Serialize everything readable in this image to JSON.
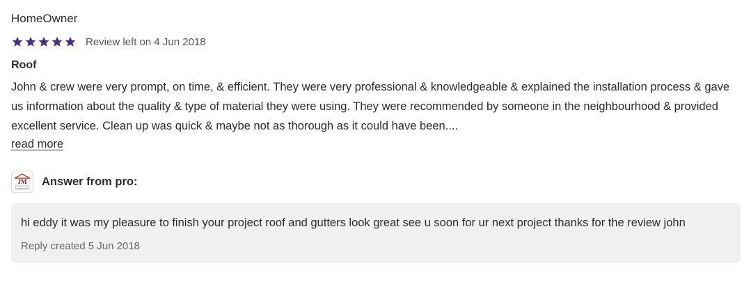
{
  "review": {
    "author": "HomeOwner",
    "rating": 5,
    "rating_max": 5,
    "star_color": "#4b2f7f",
    "date_text": "Review left on 4 Jun 2018",
    "title": "Roof",
    "body": "John & crew were very prompt, on time, & efficient. They were very professional & knowledgeable & explained the installation process & gave us information about the quality & type of material they were using. They were recommended by someone in the neighbourhood & provided excellent service. Clean up was quick & maybe not as thorough as it could have been....",
    "read_more_label": "read more"
  },
  "answer": {
    "label": "Answer from pro:",
    "logo_text": "JM",
    "logo_subtext": "Roofing Painting",
    "text": "hi eddy it was my pleasure to finish your project roof and gutters look great see u soon for ur next project thanks for the review john",
    "reply_date": "Reply created 5 Jun 2018"
  }
}
